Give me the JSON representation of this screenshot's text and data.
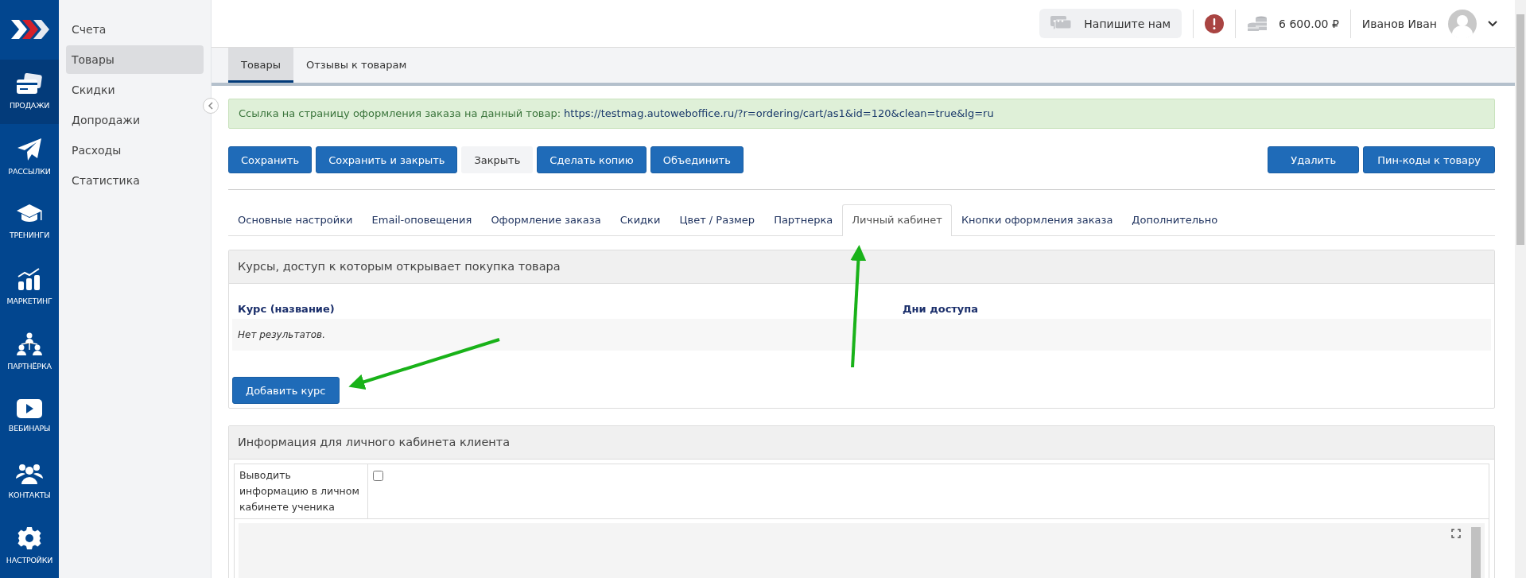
{
  "rail": [
    {
      "label": "ПРОДАЖИ",
      "kind": "card",
      "selected": true
    },
    {
      "label": "РАССЫЛКИ",
      "kind": "plane",
      "selected": false
    },
    {
      "label": "ТРЕНИНГИ",
      "kind": "cap",
      "selected": false
    },
    {
      "label": "МАРКЕТИНГ",
      "kind": "chart",
      "selected": false
    },
    {
      "label": "ПАРТНЁРКА",
      "kind": "tree",
      "selected": false
    },
    {
      "label": "ВЕБИНАРЫ",
      "kind": "play",
      "selected": false
    },
    {
      "label": "КОНТАКТЫ",
      "kind": "group",
      "selected": false
    },
    {
      "label": "НАСТРОЙКИ",
      "kind": "gear",
      "selected": false
    }
  ],
  "submenu": [
    {
      "label": "Счета",
      "selected": false
    },
    {
      "label": "Товары",
      "selected": true
    },
    {
      "label": "Скидки",
      "selected": false
    },
    {
      "label": "Допродажи",
      "selected": false
    },
    {
      "label": "Расходы",
      "selected": false
    },
    {
      "label": "Статистика",
      "selected": false
    }
  ],
  "topbar": {
    "chat_button": "Напишите нам",
    "balance": "6 600.00 ₽",
    "user": "Иванов Иван"
  },
  "page_tabs": [
    {
      "label": "Товары",
      "selected": true
    },
    {
      "label": "Отзывы к товарам",
      "selected": false
    }
  ],
  "alert": {
    "text": "Ссылка на страницу оформления заказа на данный товар:",
    "link": "https://testmag.autoweboffice.ru/?r=ordering/cart/as1&id=120&clean=true&lg=ru"
  },
  "actions_left": [
    {
      "label": "Сохранить",
      "kind": "primary"
    },
    {
      "label": "Сохранить и закрыть",
      "kind": "primary"
    },
    {
      "label": "Закрыть",
      "kind": "plain"
    },
    {
      "label": "Сделать копию",
      "kind": "primary"
    },
    {
      "label": "Объединить",
      "kind": "primary"
    }
  ],
  "actions_right": [
    {
      "label": "Удалить",
      "kind": "primary"
    },
    {
      "label": "Пин-коды к товару",
      "kind": "primary"
    }
  ],
  "section_tabs": [
    {
      "label": "Основные настройки",
      "selected": false
    },
    {
      "label": "Email-оповещения",
      "selected": false
    },
    {
      "label": "Оформление заказа",
      "selected": false
    },
    {
      "label": "Скидки",
      "selected": false
    },
    {
      "label": "Цвет / Размер",
      "selected": false
    },
    {
      "label": "Партнерка",
      "selected": false
    },
    {
      "label": "Личный кабинет",
      "selected": true
    },
    {
      "label": "Кнопки оформления заказа",
      "selected": false
    },
    {
      "label": "Дополнительно",
      "selected": false
    }
  ],
  "courses_panel": {
    "title": "Курсы, доступ к которым открывает покупка товара",
    "columns": [
      "Курс (название)",
      "Дни доступа"
    ],
    "empty_text": "Нет результатов.",
    "add_button": "Добавить курс"
  },
  "info_panel": {
    "title": "Информация для личного кабинета клиента",
    "field_label": "Выводить информацию в личном кабинете ученика",
    "checked": false
  }
}
